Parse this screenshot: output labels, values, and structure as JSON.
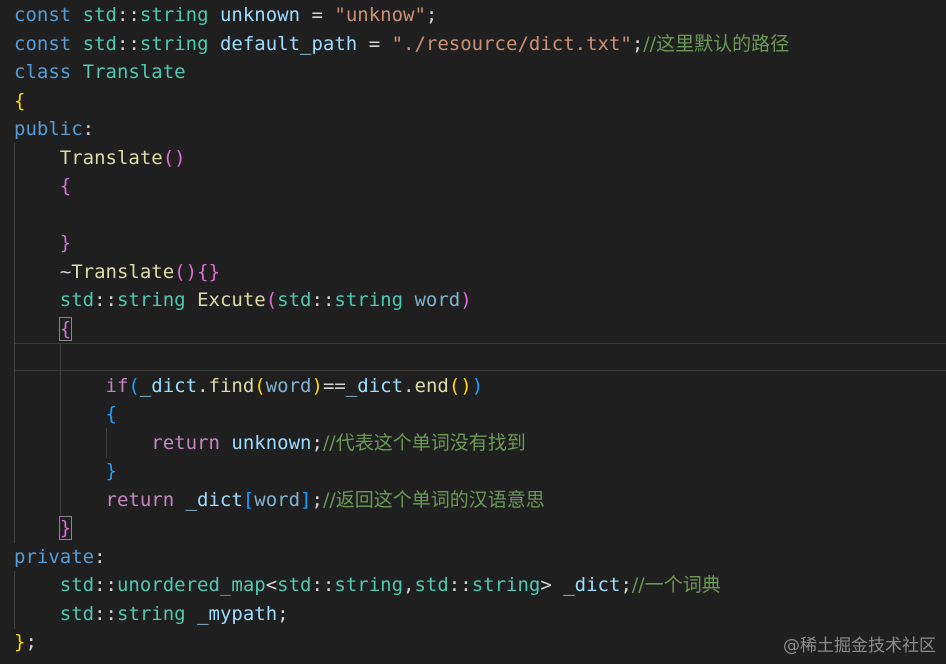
{
  "code": {
    "l1": {
      "kw": "const",
      "ns": "std",
      "op": "::",
      "ty": "string",
      "name": "unknown",
      "eq": "=",
      "str": "\"unknow\"",
      "end": ";"
    },
    "l2": {
      "kw": "const",
      "ns": "std",
      "op": "::",
      "ty": "string",
      "name": "default_path",
      "eq": "=",
      "str": "\"./resource/dict.txt\"",
      "end": ";",
      "cmt": "//这里默认的路径"
    },
    "l3": {
      "kw": "class",
      "name": "Translate"
    },
    "l4": {
      "brace": "{"
    },
    "l5": {
      "kw": "public",
      "colon": ":"
    },
    "l6": {
      "fn": "Translate",
      "open": "(",
      "close": ")"
    },
    "l7": {
      "brace": "{"
    },
    "l8": {
      "brace": "}"
    },
    "l9": {
      "tilde": "~",
      "fn": "Translate",
      "open": "(",
      "close": ")",
      "bopen": "{",
      "bclose": "}"
    },
    "l10": {
      "ns": "std",
      "op": "::",
      "ty": "string",
      "fn": "Excute",
      "open": "(",
      "ns2": "std",
      "op2": "::",
      "ty2": "string",
      "param": "word",
      "close": ")"
    },
    "l11": {
      "brace": "{"
    },
    "l12": {
      "kw": "if",
      "open": "(",
      "obj": "_dict",
      "dot": ".",
      "fn": "find",
      "open2": "(",
      "arg": "word",
      "close2": ")",
      "eqeq": "==",
      "obj2": "_dict",
      "dot2": ".",
      "fn2": "end",
      "open3": "(",
      "close3": ")",
      "close": ")"
    },
    "l13": {
      "brace": "{"
    },
    "l14": {
      "kw": "return",
      "name": "unknown",
      "end": ";",
      "cmt": "//代表这个单词没有找到"
    },
    "l15": {
      "brace": "}"
    },
    "l16": {
      "kw": "return",
      "obj": "_dict",
      "open": "[",
      "arg": "word",
      "close": "]",
      "end": ";",
      "cmt": "//返回这个单词的汉语意思"
    },
    "l17": {
      "brace": "}"
    },
    "l18": {
      "kw": "private",
      "colon": ":"
    },
    "l19": {
      "ns": "std",
      "op": "::",
      "ty": "unordered_map",
      "lt": "<",
      "ns2": "std",
      "op2": "::",
      "ty2": "string",
      "comma": ",",
      "ns3": "std",
      "op3": "::",
      "ty3": "string",
      "gt": ">",
      "name": "_dict",
      "end": ";",
      "cmt": "//一个词典"
    },
    "l20": {
      "ns": "std",
      "op": "::",
      "ty": "string",
      "name": "_mypath",
      "end": ";"
    },
    "l21": {
      "brace": "}",
      "end": ";"
    }
  },
  "watermark": "@稀土掘金技术社区",
  "colors": {
    "background": "#1f1f1f",
    "keyword": "#569cd6",
    "type": "#4ec9b0",
    "function": "#dcdcaa",
    "variable": "#9cdcfe",
    "string": "#ce9178",
    "comment": "#6a9955",
    "bracket_gold": "#ffd700",
    "bracket_orchid": "#da70d6",
    "bracket_blue": "#179fff"
  }
}
